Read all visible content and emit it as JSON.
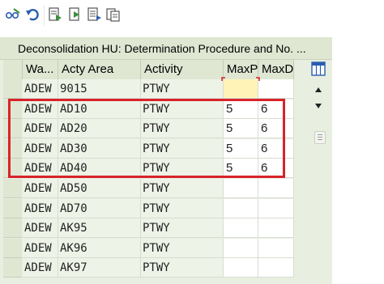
{
  "panel": {
    "title": "Deconsolidation HU: Determination Procedure and No. ..."
  },
  "columns": [
    "Wa...",
    "Acty Area",
    "Activity",
    "MaxP",
    "MaxD"
  ],
  "rows": [
    {
      "wa": "ADEW",
      "area": "9015",
      "activity": "PTWY",
      "maxp": "",
      "maxd": ""
    },
    {
      "wa": "ADEW",
      "area": "AD10",
      "activity": "PTWY",
      "maxp": "5",
      "maxd": "6"
    },
    {
      "wa": "ADEW",
      "area": "AD20",
      "activity": "PTWY",
      "maxp": "5",
      "maxd": "6"
    },
    {
      "wa": "ADEW",
      "area": "AD30",
      "activity": "PTWY",
      "maxp": "5",
      "maxd": "6"
    },
    {
      "wa": "ADEW",
      "area": "AD40",
      "activity": "PTWY",
      "maxp": "5",
      "maxd": "6"
    },
    {
      "wa": "ADEW",
      "area": "AD50",
      "activity": "PTWY",
      "maxp": "",
      "maxd": ""
    },
    {
      "wa": "ADEW",
      "area": "AD70",
      "activity": "PTWY",
      "maxp": "",
      "maxd": ""
    },
    {
      "wa": "ADEW",
      "area": "AK95",
      "activity": "PTWY",
      "maxp": "",
      "maxd": ""
    },
    {
      "wa": "ADEW",
      "area": "AK96",
      "activity": "PTWY",
      "maxp": "",
      "maxd": ""
    },
    {
      "wa": "ADEW",
      "area": "AK97",
      "activity": "PTWY",
      "maxp": "",
      "maxd": ""
    }
  ],
  "colors": {
    "highlight": "#d8232a",
    "focus_cell": "#fff3b8",
    "panel_bg": "#e9efe0",
    "header_bg": "#dfe7d3",
    "toolbar_icon_blue": "#2a5db0",
    "toolbar_icon_green": "#3d8f3a"
  },
  "icons": {
    "toolbar": [
      "glasses-pencil-icon",
      "undo-icon",
      "export-icon",
      "import-icon",
      "list-arrow-icon",
      "copy-icon"
    ],
    "grid": [
      "column-config-icon",
      "scroll-up-icon",
      "scroll-down-icon",
      "scroll-handle-icon"
    ]
  }
}
